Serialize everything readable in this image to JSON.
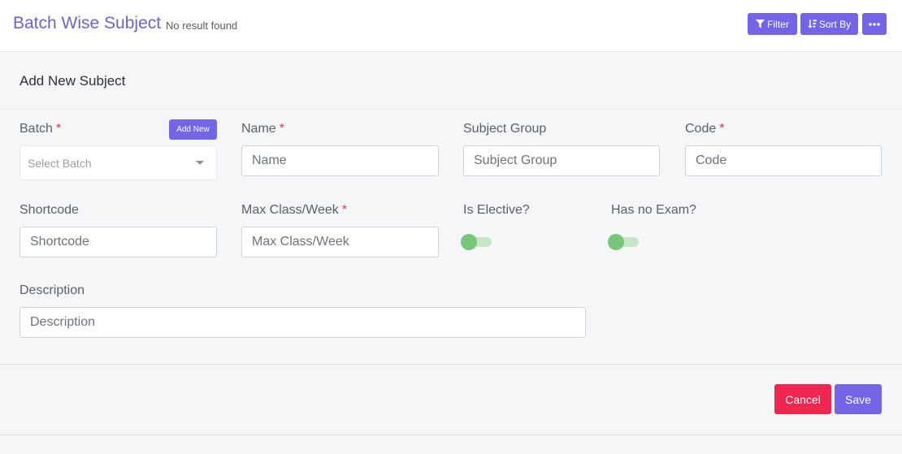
{
  "header": {
    "title": "Batch Wise Subject",
    "result_text": "No result found",
    "filter_label": "Filter",
    "sort_label": "Sort By",
    "more_icon": "ellipsis-icon"
  },
  "form": {
    "title": "Add New Subject",
    "required_mark": "*",
    "batch": {
      "label": "Batch",
      "add_new": "Add New",
      "placeholder": "Select Batch"
    },
    "name": {
      "label": "Name",
      "placeholder": "Name",
      "value": ""
    },
    "subject_group": {
      "label": "Subject Group",
      "placeholder": "Subject Group",
      "value": ""
    },
    "code": {
      "label": "Code",
      "placeholder": "Code",
      "value": ""
    },
    "shortcode": {
      "label": "Shortcode",
      "placeholder": "Shortcode",
      "value": ""
    },
    "max_class": {
      "label": "Max Class/Week",
      "placeholder": "Max Class/Week",
      "value": ""
    },
    "is_elective": {
      "label": "Is Elective?",
      "on": false
    },
    "has_no_exam": {
      "label": "Has no Exam?",
      "on": false
    },
    "description": {
      "label": "Description",
      "placeholder": "Description",
      "value": ""
    }
  },
  "actions": {
    "cancel": "Cancel",
    "save": "Save"
  },
  "colors": {
    "accent": "#7365e6",
    "title": "#7062c8",
    "danger": "#f0264f",
    "toggle": "#76c77c",
    "required": "#e33b4e"
  }
}
